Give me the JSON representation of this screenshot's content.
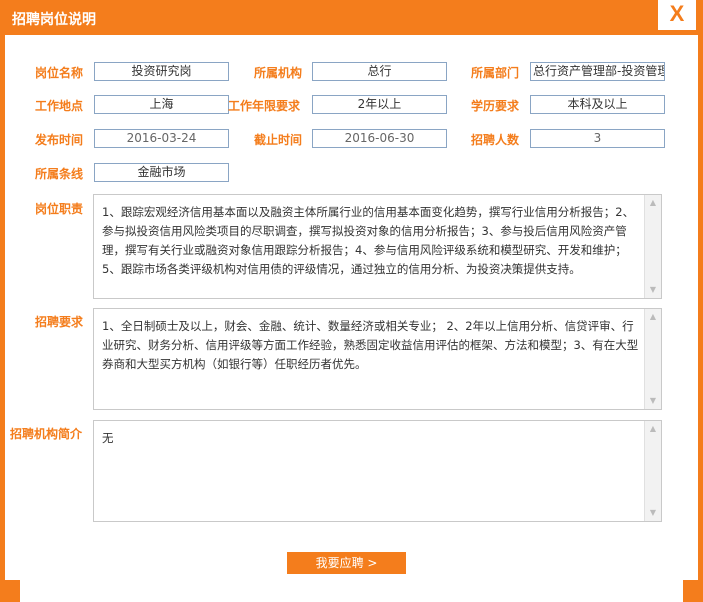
{
  "dialog": {
    "title": "招聘岗位说明",
    "close_label": "X"
  },
  "fields": {
    "position_name": {
      "label": "岗位名称",
      "value": "投资研究岗"
    },
    "institution": {
      "label": "所属机构",
      "value": "总行"
    },
    "department": {
      "label": "所属部门",
      "value": "总行资产管理部-投资管理"
    },
    "location": {
      "label": "工作地点",
      "value": "上海"
    },
    "experience": {
      "label": "工作年限要求",
      "value": "2年以上"
    },
    "education": {
      "label": "学历要求",
      "value": "本科及以上"
    },
    "publish_date": {
      "label": "发布时间",
      "value": "2016-03-24"
    },
    "deadline": {
      "label": "截止时间",
      "value": "2016-06-30"
    },
    "headcount": {
      "label": "招聘人数",
      "value": "3"
    },
    "business_line": {
      "label": "所属条线",
      "value": "金融市场"
    }
  },
  "duties": {
    "label": "岗位职责",
    "text": "1、跟踪宏观经济信用基本面以及融资主体所属行业的信用基本面变化趋势，撰写行业信用分析报告；2、参与拟投资信用风险类项目的尽职调查，撰写拟投资对象的信用分析报告；3、参与投后信用风险资产管理，撰写有关行业或融资对象信用跟踪分析报告；4、参与信用风险评级系统和模型研究、开发和维护；5、跟踪市场各类评级机构对信用债的评级情况，通过独立的信用分析、为投资决策提供支持。"
  },
  "requirements": {
    "label": "招聘要求",
    "text": "1、全日制硕士及以上，财会、金融、统计、数量经济或相关专业；  2、2年以上信用分析、信贷评审、行业研究、财务分析、信用评级等方面工作经验，熟悉固定收益信用评估的框架、方法和模型；3、有在大型券商和大型买方机构（如银行等）任职经历者优先。"
  },
  "org_intro": {
    "label": "招聘机构简介",
    "text": "无"
  },
  "apply_button": "我要应聘  >",
  "colors": {
    "accent": "#f47d1c",
    "field_border": "#8aa5c4"
  }
}
